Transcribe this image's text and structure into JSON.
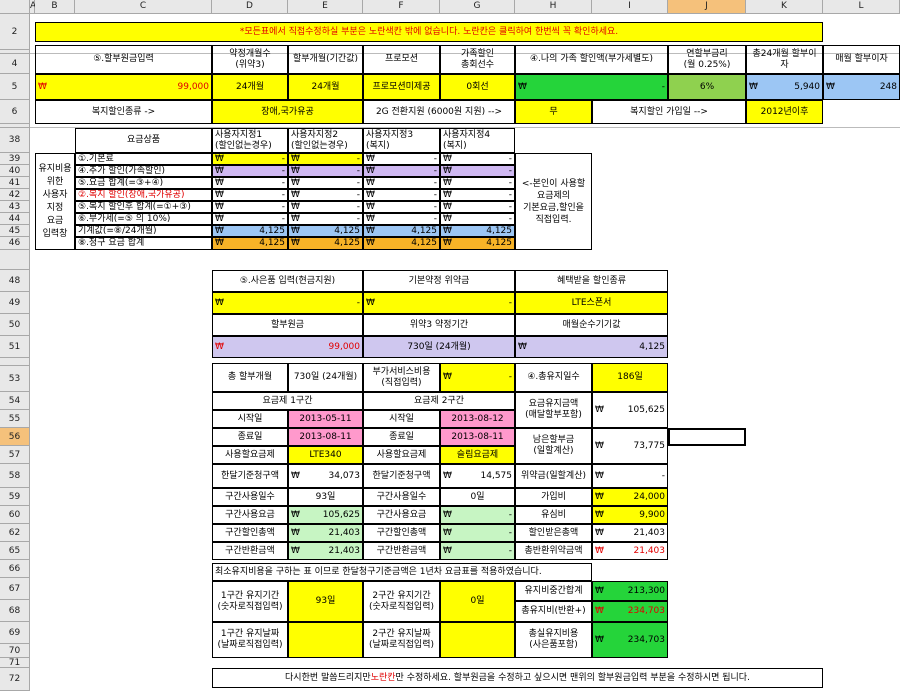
{
  "columns": [
    "A",
    "B",
    "C",
    "D",
    "E",
    "F",
    "G",
    "H",
    "I",
    "J",
    "K",
    "L"
  ],
  "rows": {
    "r2": "2",
    "r4": "4",
    "r5": "5",
    "r6": "6",
    "r38": "38",
    "r39": "39",
    "r40": "40",
    "r41": "41",
    "r42": "42",
    "r43": "43",
    "r44": "44",
    "r45": "45",
    "r46": "46",
    "r48": "48",
    "r49": "49",
    "r50": "50",
    "r51": "51",
    "r53": "53",
    "r54": "54",
    "r55": "55",
    "r56": "56",
    "r57": "57",
    "r58": "58",
    "r59": "59",
    "r60": "60",
    "r62": "62",
    "r65": "65",
    "r66": "66",
    "r67": "67",
    "r68": "68",
    "r69": "69",
    "r70": "70",
    "r71": "71",
    "r72": "72"
  },
  "notice": "*모든표에서 직접수정하실 부분은 노란색칸 밖에 없습니다. 노란칸은 클릭하여 한번씩 꼭 확인하세요.",
  "top": {
    "h_installment": "⑤.할부원금입력",
    "h_contract": "약정개월수\n(위약3)",
    "h_installment_months": "할부개월(기간값)",
    "h_promotion": "프로모션",
    "h_family_members": "가족할인\n총회선수",
    "h_family_discount": "④.나의 가족 할인액(부가세별도)",
    "h_annual_rate": "연할부금리\n(월 0.25%)",
    "h_total_interest": "총24개월 할부이자",
    "h_monthly_interest": "매월 할부이자",
    "v_installment_won": "₩",
    "v_installment": "99,000",
    "v_contract": "24개월",
    "v_installment_months": "24개월",
    "v_promotion": "프로모션미제공",
    "v_family_members": "0회선",
    "v_family_discount_won": "₩",
    "v_family_discount": "-",
    "v_annual_rate": "6%",
    "v_total_interest_won": "₩",
    "v_total_interest": "5,940",
    "v_monthly_interest_won": "₩",
    "v_monthly_interest": "248",
    "welfare_type_label": "복지할인종류 ->",
    "welfare_type_value": "장애,국가유공",
    "support_2g_label": "2G 전환지원 (6000원 지원) -->",
    "support_2g_value": "무",
    "welfare_join_label": "복지할인 가입일 -->",
    "welfare_join_value": "2012년이후"
  },
  "plan_table": {
    "side_label": "유지비용\n위한\n사용자\n지정\n요금\n입력창",
    "header_plan": "요금상품",
    "headers": [
      "사용자지정1\n(할인없는경우)",
      "사용자지정2\n(할인없는경우)",
      "사용자지정3\n(복지)",
      "사용자지정4\n(복지)"
    ],
    "row_labels": [
      "①.기본료",
      "④.추가 할인(가족할인)",
      "⑤.요금 합계(=③+④)",
      "②.복지 할인(장애,국가유공)",
      "⑤.복지 할인후 합계(=①+③)",
      "⑥.부가세(=⑤ 의 10%)",
      "기계값(=⑧/24개월)",
      "⑧.청구 요금 합계"
    ],
    "won": "₩",
    "dash": "-",
    "device_value": "4,125",
    "bill_value": "4,125",
    "note": "<-본인이 사용할\n요금제의\n기본요금,할인을\n직접입력."
  },
  "mid": {
    "gift_label": "⑤.사은품 입력(현금지원)",
    "gift_won": "₩",
    "gift_value": "-",
    "penalty_label": "기본약정 위약금",
    "penalty_won": "₩",
    "penalty_value": "-",
    "benefit_label": "혜택받을 할인종류",
    "benefit_value": "LTE스폰서",
    "installment_label": "할부원금",
    "installment_won": "₩",
    "installment_value": "99,000",
    "penalty3_label": "위약3 약정기간",
    "penalty3_value": "730일 (24개월)",
    "monthly_label": "매월순수기기값",
    "monthly_won": "₩",
    "monthly_value": "4,125"
  },
  "detail": {
    "total_months_label": "총 할부개월",
    "total_months_value": "730일 (24개월)",
    "addon_label": "부가서비스비용\n(직접입력)",
    "addon_won": "₩",
    "addon_value": "-",
    "days_label": "④.총유지일수",
    "days_value": "186일",
    "sec1_title": "요금제 1구간",
    "sec2_title": "요금제 2구간",
    "start_label": "시작일",
    "end_label": "종료일",
    "plan_label": "사용할요금제",
    "monthly_bill_label": "한달기준청구액",
    "days_used_label": "구간사용일수",
    "fee_label": "구간사용요금",
    "discount_label": "구간할인총액",
    "refund_label": "구간반환금액",
    "s1_start": "2013-05-11",
    "s1_end": "2013-08-11",
    "s1_plan": "LTE340",
    "s1_monthly": "34,073",
    "s1_days": "93일",
    "s1_fee": "105,625",
    "s1_discount": "21,403",
    "s1_refund": "21,403",
    "s2_start": "2013-08-12",
    "s2_end": "2013-08-11",
    "s2_plan": "슬림요금제",
    "s2_monthly": "14,575",
    "s2_days": "0일",
    "s2_fee": "-",
    "s2_discount": "-",
    "s2_refund": "-",
    "won": "₩",
    "keep_fee_label": "요금유지금액\n(매달할부포함)",
    "keep_fee_value": "105,625",
    "remaining_label": "남은할부금\n(일할계산)",
    "remaining_value": "73,775",
    "penalty_daily_label": "위약금(일할계산)",
    "penalty_daily_value": "-",
    "join_fee_label": "가입비",
    "join_fee_value": "24,000",
    "sim_label": "유심비",
    "sim_value": "9,900",
    "discount_received_label": "할인받은총액",
    "discount_received_value": "21,403",
    "total_refund_label": "총반환위약금액",
    "total_refund_value": "21,403",
    "min_note": "최소유지비용을 구하는 표 이므로 한달청구기준금액은 1년차 요금표를 적용하였습니다.",
    "p1_period_label": "1구간 유지기간\n(숫자로직접입력)",
    "p1_period_value": "93일",
    "p2_period_label": "2구간 유지기간\n(숫자로직접입력)",
    "p2_period_value": "0일",
    "p1_date_label": "1구간 유지날짜\n(날짜로직접입력)",
    "p2_date_label": "2구간 유지날짜\n(날짜로직접입력)",
    "maint_sum_label": "유지비중간합계",
    "maint_sum_value": "213,300",
    "maint_total_label": "총유지비(반환+)",
    "maint_total_value": "234,703",
    "real_label": "총실유지비용\n(사은품포함)",
    "real_value": "234,703"
  },
  "footer": {
    "pre": "다시한번 말씀드리지만 ",
    "highlight": "노란칸",
    "post": "만 수정하세요. 할부원금을 수정하고 싶으시면 맨위의 할부원금입력 부분을 수정하시면 됩니다."
  }
}
